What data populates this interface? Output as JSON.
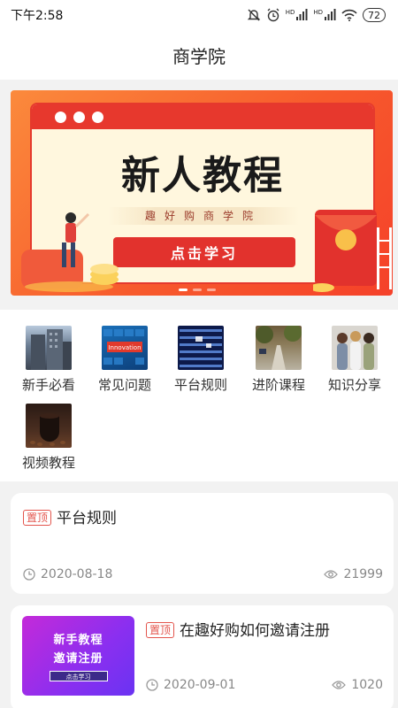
{
  "status_bar": {
    "time": "下午2:58",
    "signal1": "HD",
    "signal2": "HD",
    "battery": "72"
  },
  "header": {
    "title": "商学院"
  },
  "banner": {
    "headline": "新人教程",
    "subtitle": "趣好购商学院",
    "button_label": "点击学习",
    "pages": 3,
    "active_page": 1
  },
  "categories": [
    {
      "label": "新手必看",
      "icon": "building-photo"
    },
    {
      "label": "常见问题",
      "icon": "innovation-keyboard-photo"
    },
    {
      "label": "平台规则",
      "icon": "stock-board-photo"
    },
    {
      "label": "进阶课程",
      "icon": "street-photo"
    },
    {
      "label": "知识分享",
      "icon": "people-photo"
    },
    {
      "label": "视频教程",
      "icon": "coffee-photo"
    }
  ],
  "articles": [
    {
      "tag": "置顶",
      "title": "平台规则",
      "date": "2020-08-18",
      "views": "21999"
    },
    {
      "tag": "置顶",
      "title": "在趣好购如何邀请注册",
      "date": "2020-09-01",
      "views": "1020",
      "thumbnail": {
        "line1": "新手教程",
        "line2": "邀请注册",
        "button": "点击学习"
      }
    }
  ],
  "colors": {
    "accent": "#e3554d",
    "banner_red": "#e2322d",
    "banner_orange": "#fb8a3c"
  }
}
